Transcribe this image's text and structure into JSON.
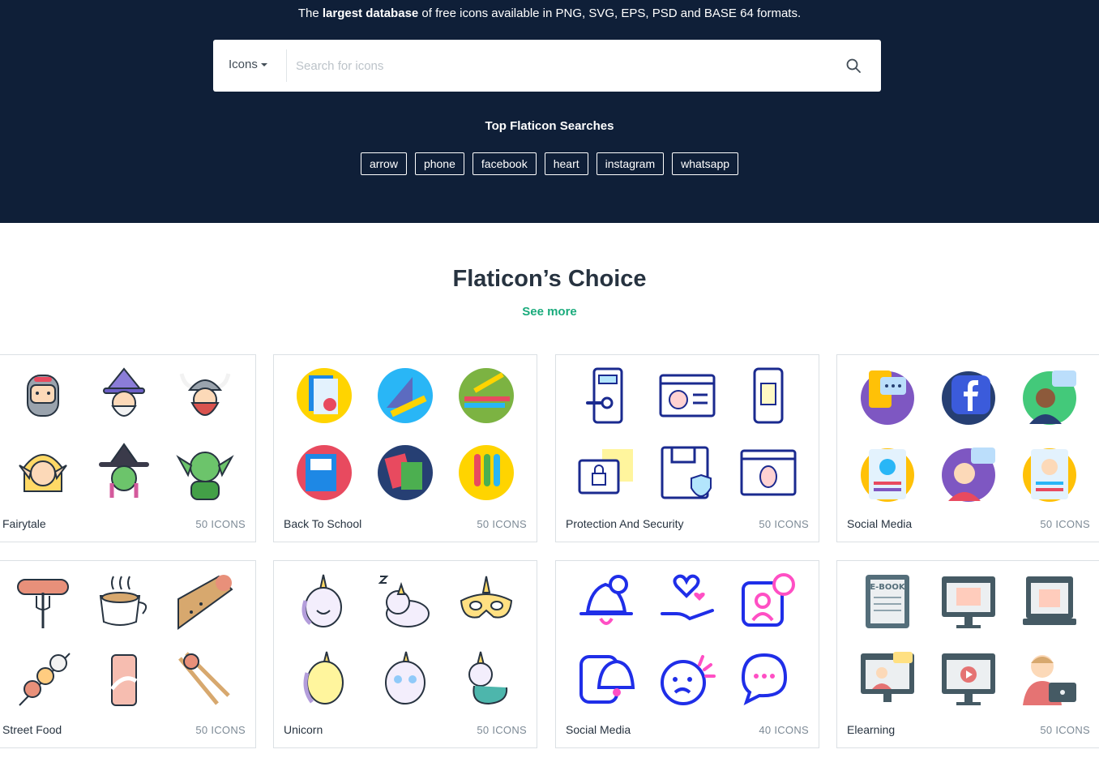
{
  "hero": {
    "tagline_prefix": "The ",
    "tagline_bold": "largest database",
    "tagline_suffix": " of free icons available in PNG, SVG, EPS, PSD and BASE 64 formats."
  },
  "search": {
    "type_label": "Icons",
    "placeholder": "Search for icons"
  },
  "top_searches": {
    "title": "Top Flaticon Searches",
    "tags": [
      "arrow",
      "phone",
      "facebook",
      "heart",
      "instagram",
      "whatsapp"
    ]
  },
  "choice": {
    "title": "Flaticon’s Choice",
    "see_more": "See more"
  },
  "packs": [
    {
      "name": "Fairytale",
      "count": "50 ICONS"
    },
    {
      "name": "Back To School",
      "count": "50 ICONS"
    },
    {
      "name": "Protection And Security",
      "count": "50 ICONS"
    },
    {
      "name": "Social Media",
      "count": "50 ICONS"
    },
    {
      "name": "Street Food",
      "count": "50 ICONS"
    },
    {
      "name": "Unicorn",
      "count": "50 ICONS"
    },
    {
      "name": "Social Media",
      "count": "40 ICONS"
    },
    {
      "name": "Elearning",
      "count": "50 ICONS"
    }
  ],
  "icons": {
    "pack_0": [
      "knight-icon",
      "wizard-icon",
      "viking-icon",
      "elf-icon",
      "witch-icon",
      "goblin-icon"
    ],
    "pack_1": [
      "notebook-icon",
      "geometry-icon",
      "pencils-icon",
      "folder-icon",
      "books-icon",
      "test-tubes-icon"
    ],
    "pack_2": [
      "door-lock-icon",
      "browser-alert-icon",
      "mobile-password-icon",
      "locked-folder-icon",
      "floppy-shield-icon",
      "bug-browser-icon"
    ],
    "pack_3": [
      "chat-phone-icon",
      "facebook-chat-icon",
      "user-chat-icon",
      "profile-card-icon",
      "woman-chat-icon",
      "profile-card-woman-icon"
    ],
    "pack_4": [
      "sausage-fork-icon",
      "coffee-cup-icon",
      "burrito-icon",
      "skewer-icon",
      "soda-can-icon",
      "chopsticks-icon"
    ],
    "pack_5": [
      "unicorn-laugh-icon",
      "unicorn-sleep-icon",
      "unicorn-mask-icon",
      "unicorn-happy-icon",
      "unicorn-cry-icon",
      "unicorn-mermaid-icon"
    ],
    "pack_6": [
      "notification-bell-icon",
      "heart-hand-icon",
      "user-message-icon",
      "bell-message-icon",
      "sad-face-icon",
      "chat-bubbles-icon"
    ],
    "pack_7": [
      "ebook-icon",
      "monitor-book-icon",
      "laptop-book-icon",
      "video-call-icon",
      "video-lesson-icon",
      "student-laptop-icon"
    ]
  }
}
